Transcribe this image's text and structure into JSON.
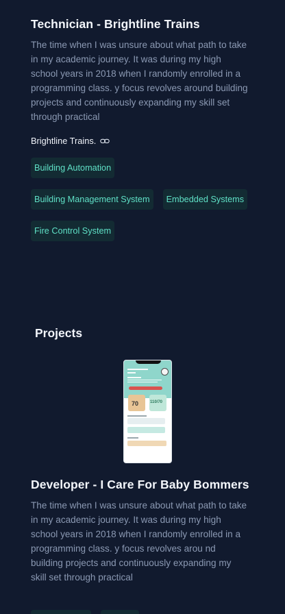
{
  "experience": {
    "title": "Technician - Brightline Trains",
    "description": "The time when I was unsure about what path to take in my academic journey. It was during my high school years in 2018 when I randomly enrolled in a programming class. y focus revolves around building projects and continuously expanding my skill set through practical",
    "company": "Brightline Trains.",
    "link_icon": "link-icon",
    "tags": [
      "Building Automation",
      "Building Management System",
      "Embedded Systems",
      "Fire Control System"
    ]
  },
  "projects": {
    "heading": "Projects",
    "items": [
      {
        "title": "Developer - I Care For Baby Bommers",
        "description": "The time when I was unsure about what path to take in my academic journey. It was during my high school years in 2018 when I randomly enrolled in a programming class. y focus revolves arou nd building projects and continuously expanding my skill set through practical",
        "phone": {
          "greeting": "Good Morning, Sam!",
          "card_a_value": "70",
          "card_b_value": "110/70"
        }
      }
    ]
  },
  "colors": {
    "background": "#111a2e",
    "tag_bg": "#132b33",
    "tag_text": "#5fe0c6",
    "muted_text": "#8b99b3"
  }
}
